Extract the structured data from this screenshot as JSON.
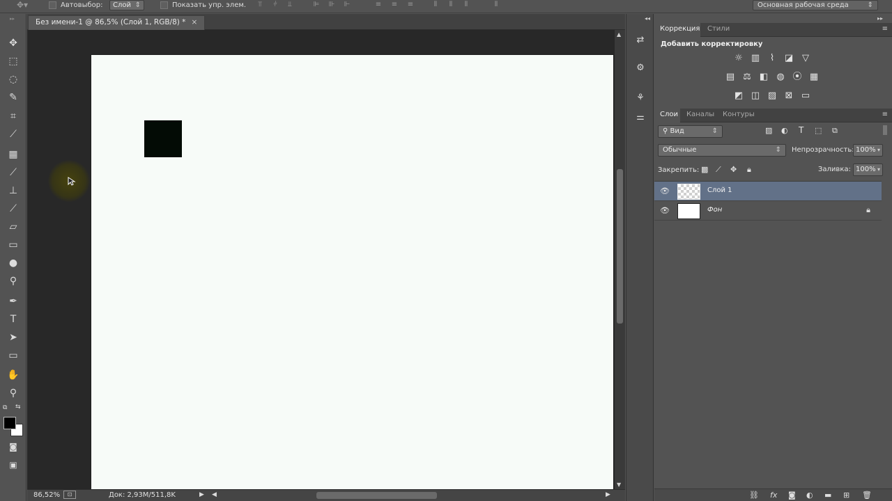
{
  "options_bar": {
    "auto_select_label": "Автовыбор:",
    "auto_select_value": "Слой",
    "show_transform_label": "Показать упр. элем.",
    "workspace": "Основная рабочая среда"
  },
  "document": {
    "tab_title": "Без имени-1 @ 86,5% (Слой 1, RGB/8) *",
    "close_glyph": "×"
  },
  "status_bar": {
    "zoom": "86,52%",
    "doc_info": "Док: 2,93M/511,8K"
  },
  "adjustments_panel": {
    "tabs": [
      "Коррекция",
      "Стили"
    ],
    "active_tab": "Коррекция",
    "title": "Добавить корректировку"
  },
  "layers_panel": {
    "tabs": [
      "Слои",
      "Каналы",
      "Контуры"
    ],
    "active_tab": "Слои",
    "filter_kind": "Вид",
    "blend_mode": "Обычные",
    "opacity_label": "Непрозрачность:",
    "opacity_value": "100%",
    "lock_label": "Закрепить:",
    "fill_label": "Заливка:",
    "fill_value": "100%",
    "layers": [
      {
        "name": "Слой 1",
        "selected": true,
        "thumb": "transparent",
        "locked": false
      },
      {
        "name": "Фон",
        "selected": false,
        "thumb": "white",
        "locked": true
      }
    ]
  },
  "colors": {
    "foreground": "#000000",
    "background": "#ffffff",
    "selection": "#627188",
    "canvas": "#f7fbf8"
  }
}
